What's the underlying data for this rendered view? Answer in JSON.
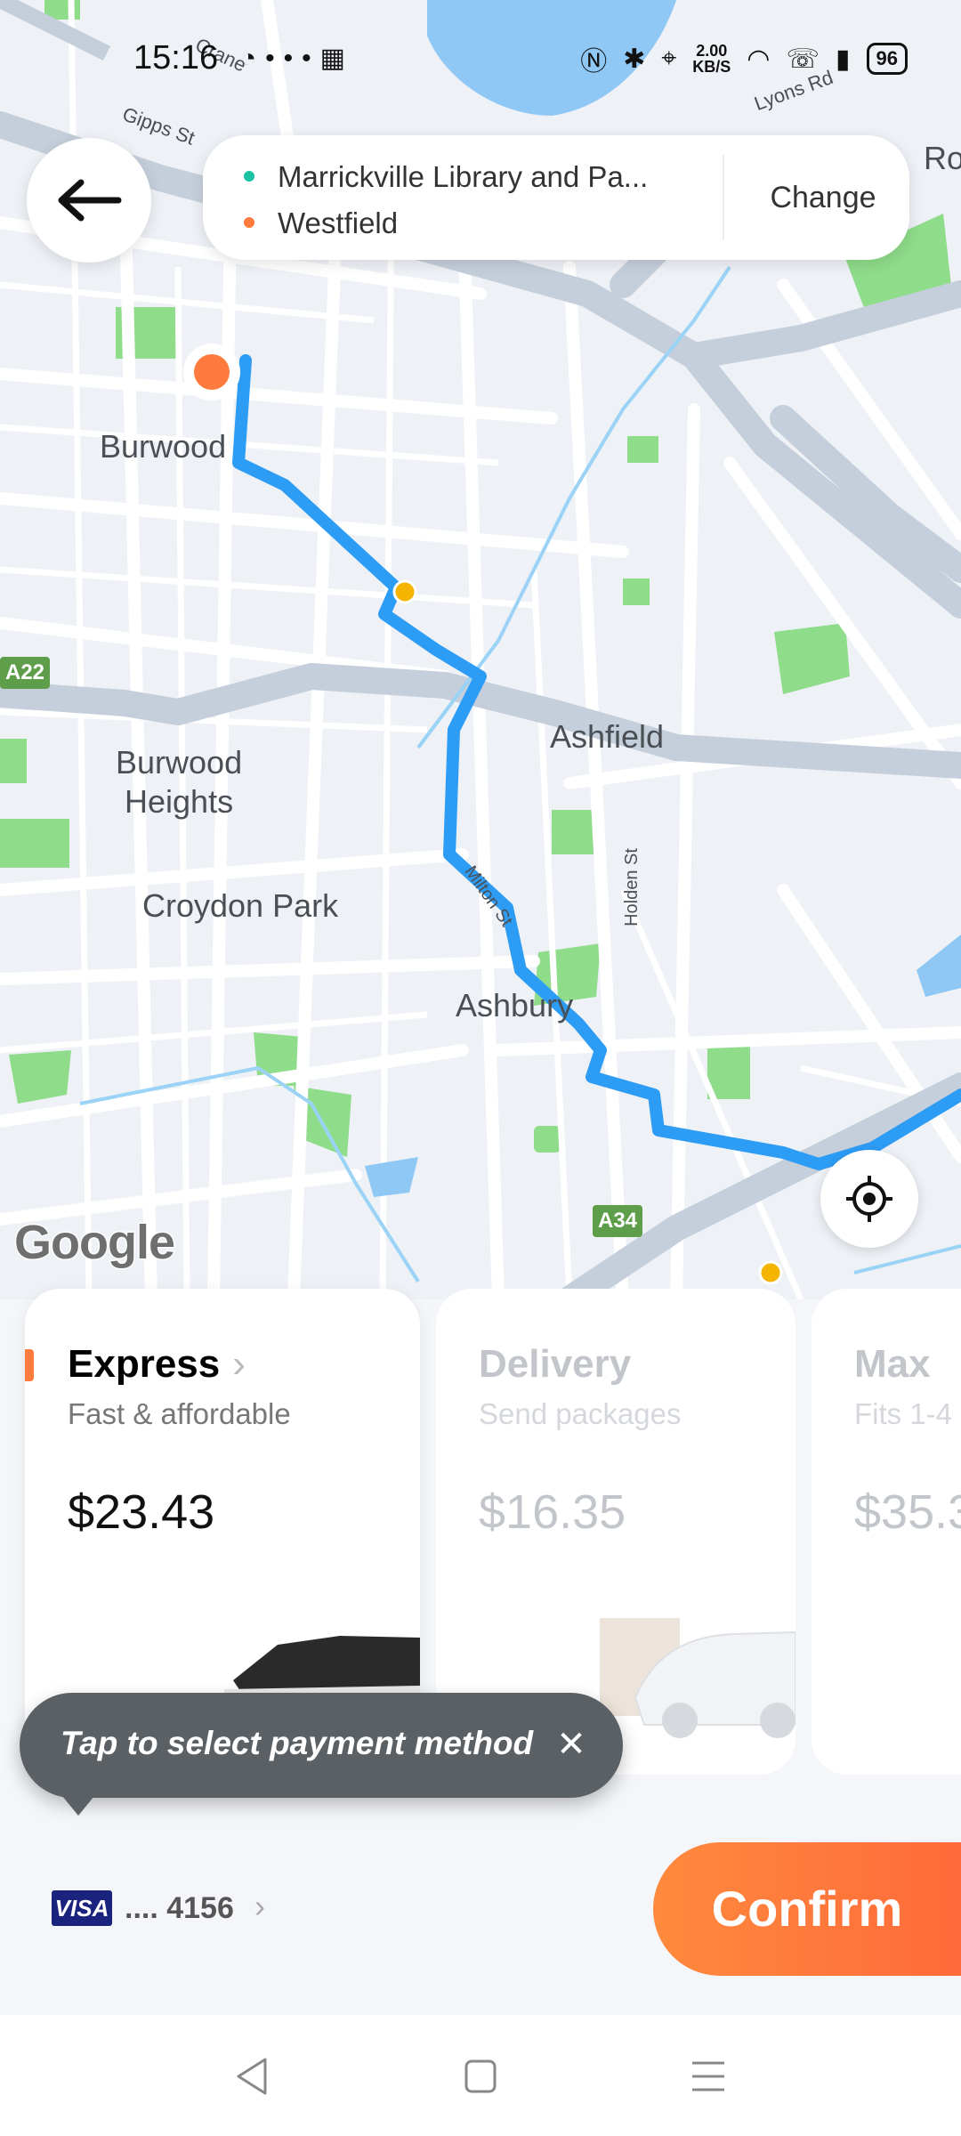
{
  "status_bar": {
    "time": "15:16",
    "left_icons": [
      "chart-icon",
      "more-dots-icon",
      "calendar-icon"
    ],
    "net_speed_value": "2.00",
    "net_speed_unit": "KB/S",
    "battery": "96"
  },
  "map": {
    "labels": {
      "burwood": "Burwood",
      "burwood_heights": "Burwood\nHeights",
      "croydon_park": "Croydon Park",
      "ashfield": "Ashfield",
      "ashbury": "Ashbury",
      "milton_st": "Milton St",
      "holden_st": "Holden St",
      "gipps_st": "Gipps St",
      "lyons_rd": "Lyons Rd",
      "crane": "Crane",
      "ro": "Ro",
      "a22": "A22",
      "a34": "A34"
    },
    "attribution": "Google",
    "route_color": "#2d9cf5"
  },
  "header": {
    "back_icon": "arrow-left-icon",
    "from": "Marrickville Library and Pa...",
    "to": "Westfield",
    "from_color": "#19c3a4",
    "to_color": "#ff7a3d",
    "change_label": "Change"
  },
  "ride_options": [
    {
      "name": "Express",
      "subtitle": "Fast & affordable",
      "price": "$23.43",
      "selected": true
    },
    {
      "name": "Delivery",
      "subtitle": "Send packages",
      "price": "$16.35",
      "selected": false
    },
    {
      "name": "Max",
      "subtitle": "Fits 1-4",
      "price": "$35.3",
      "selected": false
    }
  ],
  "tooltip": {
    "text": "Tap to select payment method",
    "close_icon": "close-icon"
  },
  "payment": {
    "brand": "VISA",
    "masked_number": ".... 4156"
  },
  "confirm_label": "Confirm",
  "accent_color": "#ff7a3d"
}
